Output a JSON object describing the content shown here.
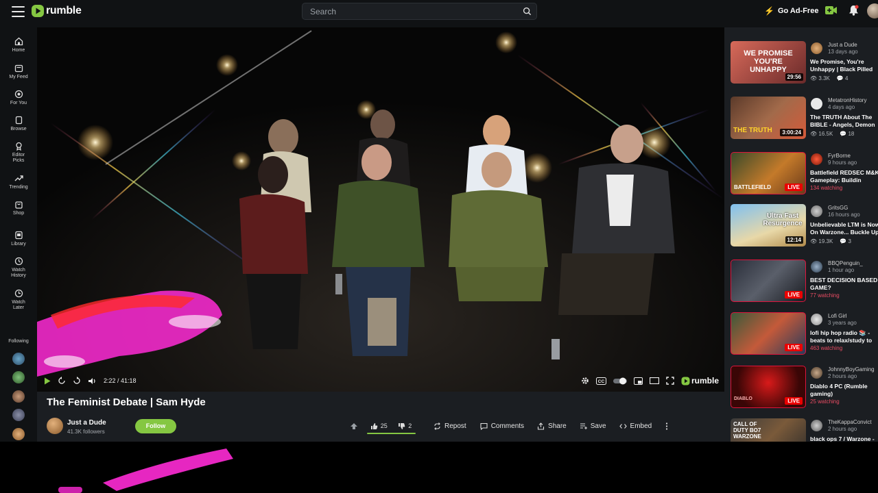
{
  "header": {
    "logo_text": "rumble",
    "search_placeholder": "Search",
    "go_ad_free": "Go Ad-Free",
    "accent_color": "#85c742"
  },
  "sidebar": {
    "items": [
      {
        "label": "Home",
        "icon": "home-icon"
      },
      {
        "label": "My Feed",
        "icon": "feed-icon"
      },
      {
        "label": "For You",
        "icon": "for-you-icon"
      },
      {
        "label": "Browse",
        "icon": "browse-icon"
      },
      {
        "label": "Editor Picks",
        "icon": "editor-picks-icon"
      },
      {
        "label": "Trending",
        "icon": "trending-icon"
      },
      {
        "label": "Shop",
        "icon": "shop-icon"
      },
      {
        "label": "Library",
        "icon": "library-icon"
      },
      {
        "label": "Watch History",
        "icon": "history-icon"
      },
      {
        "label": "Watch Later",
        "icon": "clock-icon"
      }
    ],
    "following_label": "Following"
  },
  "player": {
    "time": "2:22 / 41:18",
    "logo_text": "rumble"
  },
  "video": {
    "title": "The Feminist Debate | Sam Hyde",
    "channel": "Just a Dude",
    "followers": "41.3K followers",
    "follow_label": "Follow",
    "likes": "25",
    "dislikes": "2",
    "actions": {
      "repost": "Repost",
      "comments": "Comments",
      "share": "Share",
      "save": "Save",
      "embed": "Embed"
    }
  },
  "recommendations": [
    {
      "channel": "Just a Dude",
      "ago": "13 days ago",
      "title": "We Promise, You're Unhappy | Black Pilled",
      "views": "3.3K",
      "comments": "4",
      "duration": "29:56",
      "live": false,
      "thumb_text": "WE PROMISE YOU'RE UNHAPPY"
    },
    {
      "channel": "MetatronHistory",
      "ago": "4 days ago",
      "title": "The TRUTH About The BIBLE - Angels, Demon",
      "views": "16.5K",
      "comments": "18",
      "duration": "3:00:24",
      "live": false,
      "thumb_text": "THE TRUTH"
    },
    {
      "channel": "FyrBorne",
      "ago": "9 hours ago",
      "title": "Battlefield REDSEC M&K Gameplay: Buildin",
      "watching": "134 watching",
      "live": true,
      "thumb_text": "BATTLEFIELD"
    },
    {
      "channel": "GritsGG",
      "ago": "16 hours ago",
      "title": "Unbelievable LTM is Now On Warzone... Buckle Up",
      "views": "19.3K",
      "comments": "3",
      "duration": "12:14",
      "live": false,
      "thumb_text": "Ultra Fast Resurgence"
    },
    {
      "channel": "BBQPenguin_",
      "ago": "1 hour ago",
      "title": "BEST DECISION BASED GAME?",
      "watching": "77 watching",
      "live": true,
      "thumb_text": ""
    },
    {
      "channel": "Lofi Girl",
      "ago": "3 years ago",
      "title": "lofi hip hop radio 📚 - beats to relax/study to",
      "watching": "463 watching",
      "live": true,
      "thumb_text": ""
    },
    {
      "channel": "JohnnyBoyGaming",
      "ago": "2 hours ago",
      "title": "Diablo 4 PC (Rumble gaming)",
      "watching": "25 watching",
      "live": true,
      "thumb_text": "DIABLO"
    },
    {
      "channel": "TheKappaConvict",
      "ago": "2 hours ago",
      "title": "black ops 7 / Warzone -",
      "live": false,
      "thumb_text": "CALL OF DUTY BO7 WARZONE"
    }
  ]
}
